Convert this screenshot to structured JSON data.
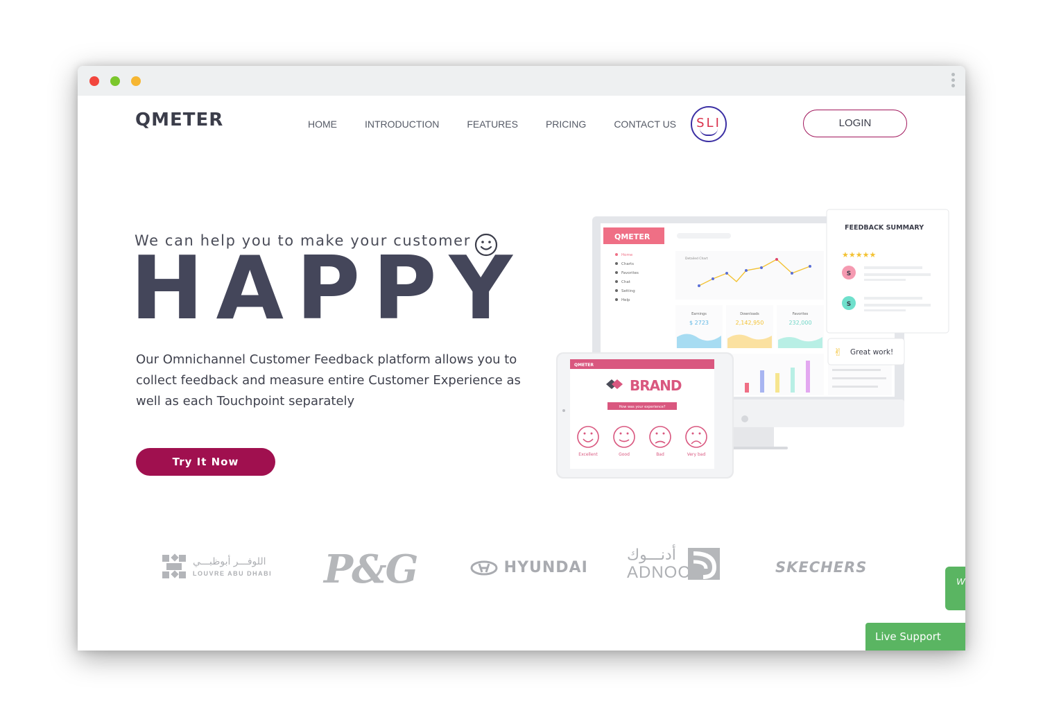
{
  "window": {
    "controls": [
      "close",
      "minimize",
      "zoom"
    ]
  },
  "header": {
    "logo_text": "QMETER",
    "nav": [
      {
        "label": "HOME"
      },
      {
        "label": "INTRODUCTION"
      },
      {
        "label": "FEATURES"
      },
      {
        "label": "PRICING"
      },
      {
        "label": "CONTACT US"
      }
    ],
    "badge_text": "SLI",
    "login_label": "LOGIN"
  },
  "hero": {
    "tagline": "We can help you to make your customer",
    "headline": "HAPPY",
    "description": "Our Omnichannel Customer Feedback platform allows you to collect feedback and measure entire Customer Experience as well as each Touchpoint separately",
    "cta_label": "Try It Now"
  },
  "illustration": {
    "dashboard_logo": "QMETER",
    "sidebar_items": [
      "Home",
      "Charts",
      "Favorites",
      "Chat",
      "Setting",
      "Help"
    ],
    "chart_title": "Detailed Chart",
    "stats": [
      {
        "label": "Earnings",
        "value": "$ 2723"
      },
      {
        "label": "Downloads",
        "value": "2,142,950"
      },
      {
        "label": "Favorites",
        "value": "232,000"
      }
    ],
    "feedback_card_title": "FEEDBACK SUMMARY",
    "feedback_rating": "★★★★★",
    "feedback_avatar_letter": "S",
    "great_work": "Great work!",
    "tablet_header": "QMETER",
    "tablet_brand": "BRAND",
    "tablet_question": "How was your experience?",
    "faces": [
      "Excellent",
      "Good",
      "Bad",
      "Very bad"
    ]
  },
  "clients": {
    "louvre_ar": "اللوفـــر أبوظبـــي",
    "louvre_en": "LOUVRE ABU DHABI",
    "pg": "P&G",
    "hyundai": "HYUNDAI",
    "adnoc_ar": "أدنـــوك",
    "adnoc_en": "ADNOC",
    "skechers": "SKECHERS"
  },
  "side_tab_text": "W",
  "live_support_label": "Live Support",
  "colors": {
    "accent": "#a0104f",
    "heading": "#44465a",
    "support_green": "#5ab562",
    "pink": "#e0607e"
  }
}
